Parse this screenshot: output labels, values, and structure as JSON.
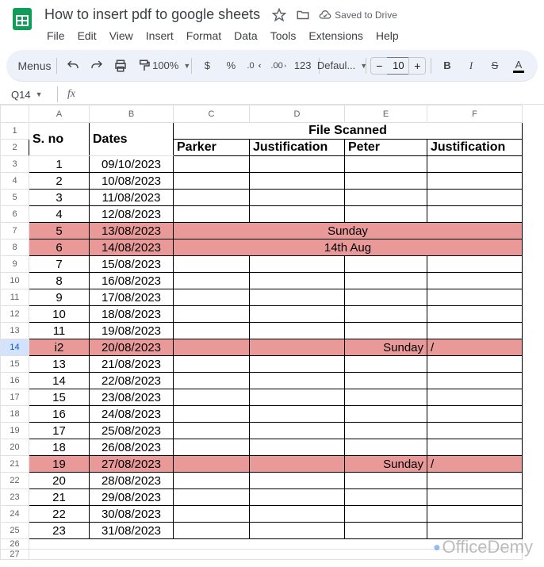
{
  "doc": {
    "title": "How to insert pdf to google sheets",
    "saved": "Saved to Drive"
  },
  "menu": {
    "file": "File",
    "edit": "Edit",
    "view": "View",
    "insert": "Insert",
    "format": "Format",
    "data": "Data",
    "tools": "Tools",
    "extensions": "Extensions",
    "help": "Help"
  },
  "toolbar": {
    "menus": "Menus",
    "zoom": "100%",
    "currency": "$",
    "percent": "%",
    "decdec": ".0",
    "incdec": ".00",
    "numfmt": "123",
    "font": "Defaul...",
    "minus": "−",
    "fontsize": "10",
    "plus": "+",
    "bold": "B",
    "italic": "I",
    "strike": "S",
    "textA": "A"
  },
  "namebox": {
    "ref": "Q14"
  },
  "cols": {
    "A": "A",
    "B": "B",
    "C": "C",
    "D": "D",
    "E": "E",
    "F": "F"
  },
  "hdr": {
    "sno": "S. no",
    "dates": "Dates",
    "filescanned": "File Scanned",
    "parker": "Parker",
    "just1": "Justification",
    "peter": "Peter",
    "just2": "Justification"
  },
  "rows": [
    {
      "n": "1",
      "s": "1",
      "d": "09/10/2023",
      "c": "",
      "dd": "",
      "e": "",
      "f": "",
      "red": false,
      "merge": ""
    },
    {
      "n": "2",
      "s": "2",
      "d": "10/08/2023",
      "c": "",
      "dd": "",
      "e": "",
      "f": "",
      "red": false,
      "merge": ""
    },
    {
      "n": "3",
      "s": "3",
      "d": "11/08/2023",
      "c": "",
      "dd": "",
      "e": "",
      "f": "",
      "red": false,
      "merge": ""
    },
    {
      "n": "4",
      "s": "4",
      "d": "12/08/2023",
      "c": "",
      "dd": "",
      "e": "",
      "f": "",
      "red": false,
      "merge": ""
    },
    {
      "n": "5",
      "s": "5",
      "d": "13/08/2023",
      "merge": "Sunday",
      "red": true
    },
    {
      "n": "6",
      "s": "6",
      "d": "14/08/2023",
      "merge": "14th Aug",
      "red": true
    },
    {
      "n": "7",
      "s": "7",
      "d": "15/08/2023",
      "c": "",
      "dd": "",
      "e": "",
      "f": "",
      "red": false,
      "merge": ""
    },
    {
      "n": "8",
      "s": "8",
      "d": "16/08/2023",
      "c": "",
      "dd": "",
      "e": "",
      "f": "",
      "red": false,
      "merge": ""
    },
    {
      "n": "9",
      "s": "9",
      "d": "17/08/2023",
      "c": "",
      "dd": "",
      "e": "",
      "f": "",
      "red": false,
      "merge": ""
    },
    {
      "n": "10",
      "s": "10",
      "d": "18/08/2023",
      "c": "",
      "dd": "",
      "e": "",
      "f": "",
      "red": false,
      "merge": ""
    },
    {
      "n": "11",
      "s": "11",
      "d": "19/08/2023",
      "c": "",
      "dd": "",
      "e": "",
      "f": "",
      "red": false,
      "merge": ""
    },
    {
      "n": "12",
      "s": "i2",
      "d": "20/08/2023",
      "c": "",
      "dd": "",
      "e": "Sunday",
      "f": "/",
      "red": true,
      "merge": ""
    },
    {
      "n": "13",
      "s": "13",
      "d": "21/08/2023",
      "c": "",
      "dd": "",
      "e": "",
      "f": "",
      "red": false,
      "merge": ""
    },
    {
      "n": "14",
      "s": "14",
      "d": "22/08/2023",
      "c": "",
      "dd": "",
      "e": "",
      "f": "",
      "red": false,
      "merge": ""
    },
    {
      "n": "15",
      "s": "15",
      "d": "23/08/2023",
      "c": "",
      "dd": "",
      "e": "",
      "f": "",
      "red": false,
      "merge": ""
    },
    {
      "n": "16",
      "s": "16",
      "d": "24/08/2023",
      "c": "",
      "dd": "",
      "e": "",
      "f": "",
      "red": false,
      "merge": ""
    },
    {
      "n": "17",
      "s": "17",
      "d": "25/08/2023",
      "c": "",
      "dd": "",
      "e": "",
      "f": "",
      "red": false,
      "merge": ""
    },
    {
      "n": "18",
      "s": "18",
      "d": "26/08/2023",
      "c": "",
      "dd": "",
      "e": "",
      "f": "",
      "red": false,
      "merge": ""
    },
    {
      "n": "19",
      "s": "19",
      "d": "27/08/2023",
      "c": "",
      "dd": "",
      "e": "Sunday",
      "f": "/",
      "red": true,
      "merge": ""
    },
    {
      "n": "20",
      "s": "20",
      "d": "28/08/2023",
      "c": "",
      "dd": "",
      "e": "",
      "f": "",
      "red": false,
      "merge": ""
    },
    {
      "n": "21",
      "s": "21",
      "d": "29/08/2023",
      "c": "",
      "dd": "",
      "e": "",
      "f": "",
      "red": false,
      "merge": ""
    },
    {
      "n": "22",
      "s": "22",
      "d": "30/08/2023",
      "c": "",
      "dd": "",
      "e": "",
      "f": "",
      "red": false,
      "merge": ""
    },
    {
      "n": "23",
      "s": "23",
      "d": "31/08/2023",
      "c": "",
      "dd": "",
      "e": "",
      "f": "",
      "red": false,
      "merge": ""
    }
  ],
  "watermark": "OfficeDemy"
}
